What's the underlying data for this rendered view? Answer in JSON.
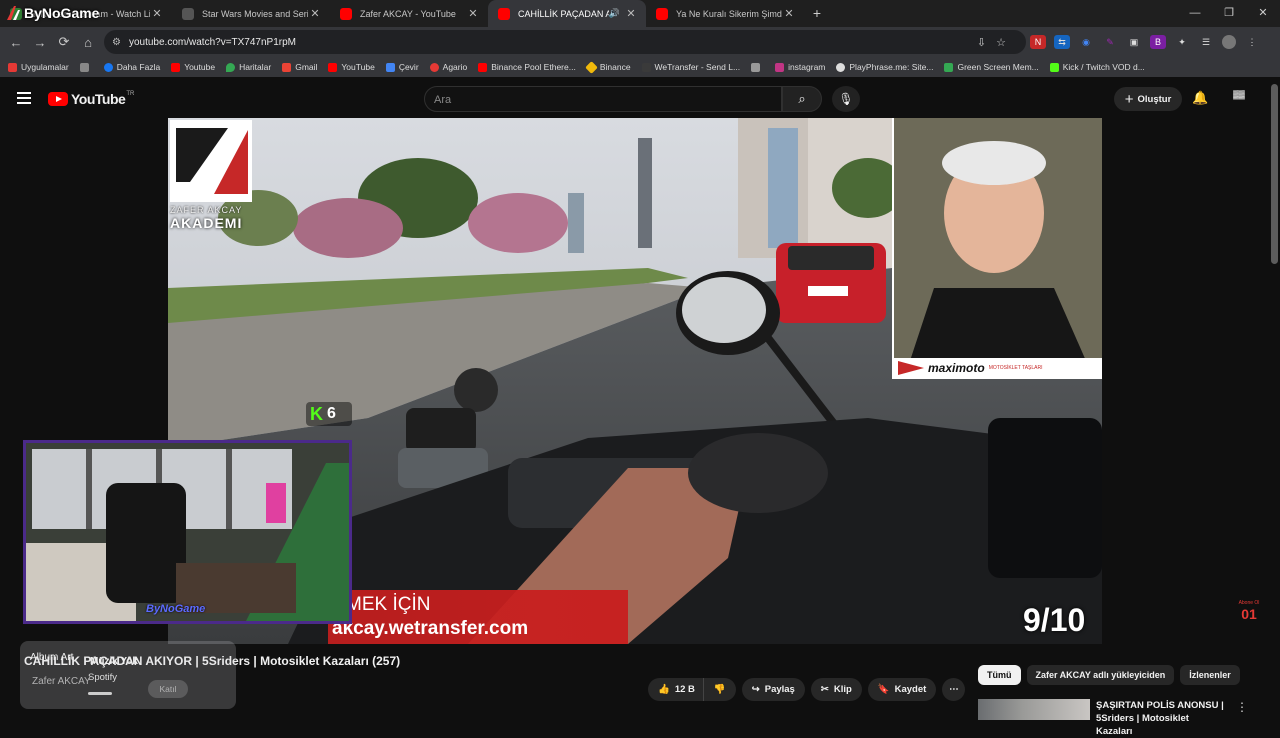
{
  "browser": {
    "tabs": [
      {
        "title": "ByNoGame Stream - Watch Live",
        "favicon_color": "#2e7d32",
        "active": false
      },
      {
        "title": "Star Wars Movies and Series Vi",
        "favicon_color": "#444444",
        "active": false
      },
      {
        "title": "Zafer AKCAY - YouTube",
        "favicon_color": "#ff0000",
        "active": false
      },
      {
        "title": "CAHİLLİK PAÇADAN AKIYOR",
        "favicon_color": "#ff0000",
        "active": true,
        "audio": true
      },
      {
        "title": "Ya Ne Kuralı Sikerim Şimdi Kura",
        "favicon_color": "#ff0000",
        "active": false
      }
    ],
    "new_tab": "+",
    "url": "youtube.com/watch?v=TX747nP1rpM",
    "bookmarks": [
      {
        "label": "Uygulamalar",
        "color": "#e53935"
      },
      {
        "label": "Daha Fazla",
        "color": "#1877f2"
      },
      {
        "label": "Youtube",
        "color": "#ff0000"
      },
      {
        "label": "Haritalar",
        "color": "#34a853"
      },
      {
        "label": "Gmail",
        "color": "#ea4335"
      },
      {
        "label": "YouTube",
        "color": "#ff0000"
      },
      {
        "label": "Çevir",
        "color": "#4285f4"
      },
      {
        "label": "Agario",
        "color": "#e53935"
      },
      {
        "label": "Binance Pool Ethere...",
        "color": "#ff0000"
      },
      {
        "label": "Binance",
        "color": "#f0b90b"
      },
      {
        "label": "WeTransfer - Send L...",
        "color": "#3a3a3a"
      },
      {
        "label": "instagram",
        "color": "#c13584"
      },
      {
        "label": "PlayPhrase.me: Site...",
        "color": "#dddddd"
      },
      {
        "label": "Green Screen Mem...",
        "color": "#34a853"
      },
      {
        "label": "Kick / Twitch VOD d...",
        "color": "#53fc18"
      }
    ]
  },
  "youtube": {
    "logo_text": "YouTube",
    "logo_country": "TR",
    "search_placeholder": "Ara",
    "create_label": "Oluştur",
    "video": {
      "title": "CAHİLLİK PAÇADAN AKIYOR | 5Sriders | Motosiklet Kazaları (257)",
      "channel": "Zafer AKCAY",
      "subscribe_label": "Katıl",
      "brand_top": "ZAFER AKCAY",
      "brand_bottom": "AKADEMI",
      "counter": "9/10",
      "banner_text": "MEK İÇİN",
      "banner_url": "akcay.wetransfer.com",
      "k_badge": "6",
      "sponsor": "maximoto",
      "sponsor_sub": "MOTOSİKLET TAŞLARI"
    },
    "actions": {
      "likes": "12 B",
      "share": "Paylaş",
      "clip": "Klip",
      "save": "Kaydet"
    },
    "chips": [
      "Tümü",
      "Zafer AKCAY adlı yükleyiciden",
      "İzlenenler"
    ],
    "recommended": {
      "title": "ŞAŞIRTAN POLİS ANONSU | 5Sriders | Motosiklet Kazaları"
    }
  },
  "overlays": {
    "stream_brand": "ByNoGame",
    "music_album": "Album Art",
    "music_title": "Müzik Yok",
    "music_source": "Spotify",
    "streamer_sign": "ByNoGame",
    "abone": "Abone Ol",
    "abone_number": "01"
  }
}
